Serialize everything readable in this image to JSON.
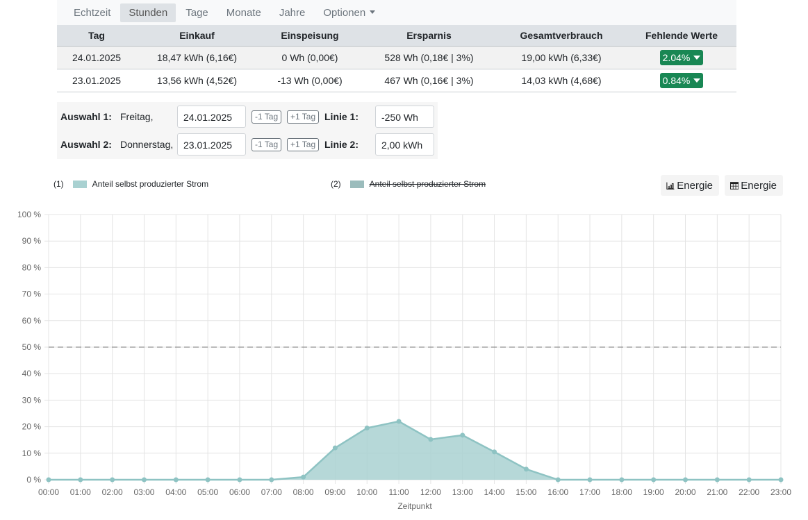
{
  "nav": {
    "items": [
      "Echtzeit",
      "Stunden",
      "Tage",
      "Monate",
      "Jahre"
    ],
    "active": "Stunden",
    "options_label": "Optionen"
  },
  "table": {
    "headers": [
      "Tag",
      "Einkauf",
      "Einspeisung",
      "Ersparnis",
      "Gesamtverbrauch",
      "Fehlende Werte"
    ],
    "rows": [
      {
        "tag": "24.01.2025",
        "einkauf": "18,47 kWh (6,16€)",
        "einspeisung": "0 Wh (0,00€)",
        "ersparnis": "528 Wh (0,18€ | 3%)",
        "gesamt": "19,00 kWh (6,33€)",
        "fehlend": "2.04%"
      },
      {
        "tag": "23.01.2025",
        "einkauf": "13,56 kWh (4,52€)",
        "einspeisung": "-13 Wh (0,00€)",
        "ersparnis": "467 Wh (0,16€ | 3%)",
        "gesamt": "14,03 kWh (4,68€)",
        "fehlend": "0.84%"
      }
    ]
  },
  "selection": {
    "row1": {
      "label": "Auswahl 1:",
      "day": "Freitag,",
      "date": "24.01.2025",
      "minus": "-1 Tag",
      "plus": "+1 Tag",
      "line_label": "Linie 1:",
      "line_value": "-250 Wh"
    },
    "row2": {
      "label": "Auswahl 2:",
      "day": "Donnerstag,",
      "date": "23.01.2025",
      "minus": "-1 Tag",
      "plus": "+1 Tag",
      "line_label": "Linie 2:",
      "line_value": "2,00 kWh"
    }
  },
  "legend": {
    "item1": {
      "num": "(1)",
      "text": "Anteil selbst produzierter Strom"
    },
    "item2": {
      "num": "(2)",
      "text": "Anteil selbst produzierter Strom"
    }
  },
  "view_buttons": {
    "chart_label": "Energie",
    "table_label": "Energie",
    "chart_icon": "bar-chart-icon",
    "table_icon": "table-icon"
  },
  "colors": {
    "series1_fill": "#a9d1d1",
    "series1_line": "#8ec3c3",
    "series2_swatch": "#9bbcbc",
    "badge": "#198754"
  },
  "chart_data": {
    "type": "area",
    "xlabel": "Zeitpunkt",
    "ylabel": "",
    "x": [
      "00:00",
      "01:00",
      "02:00",
      "03:00",
      "04:00",
      "05:00",
      "06:00",
      "07:00",
      "08:00",
      "09:00",
      "10:00",
      "11:00",
      "12:00",
      "13:00",
      "14:00",
      "15:00",
      "16:00",
      "17:00",
      "18:00",
      "19:00",
      "20:00",
      "21:00",
      "22:00",
      "23:00"
    ],
    "y_ticks": [
      "0 %",
      "10 %",
      "20 %",
      "30 %",
      "40 %",
      "50 %",
      "60 %",
      "70 %",
      "80 %",
      "90 %",
      "100 %"
    ],
    "ylim": [
      0,
      100
    ],
    "grid": true,
    "reference_line": 50,
    "series": [
      {
        "name": "Anteil selbst produzierter Strom",
        "values": [
          0,
          0,
          0,
          0,
          0,
          0,
          0,
          0,
          1,
          12,
          19.5,
          22,
          15.2,
          16.8,
          10.5,
          4,
          0,
          0,
          0,
          0,
          0,
          0,
          0,
          0
        ]
      }
    ]
  }
}
